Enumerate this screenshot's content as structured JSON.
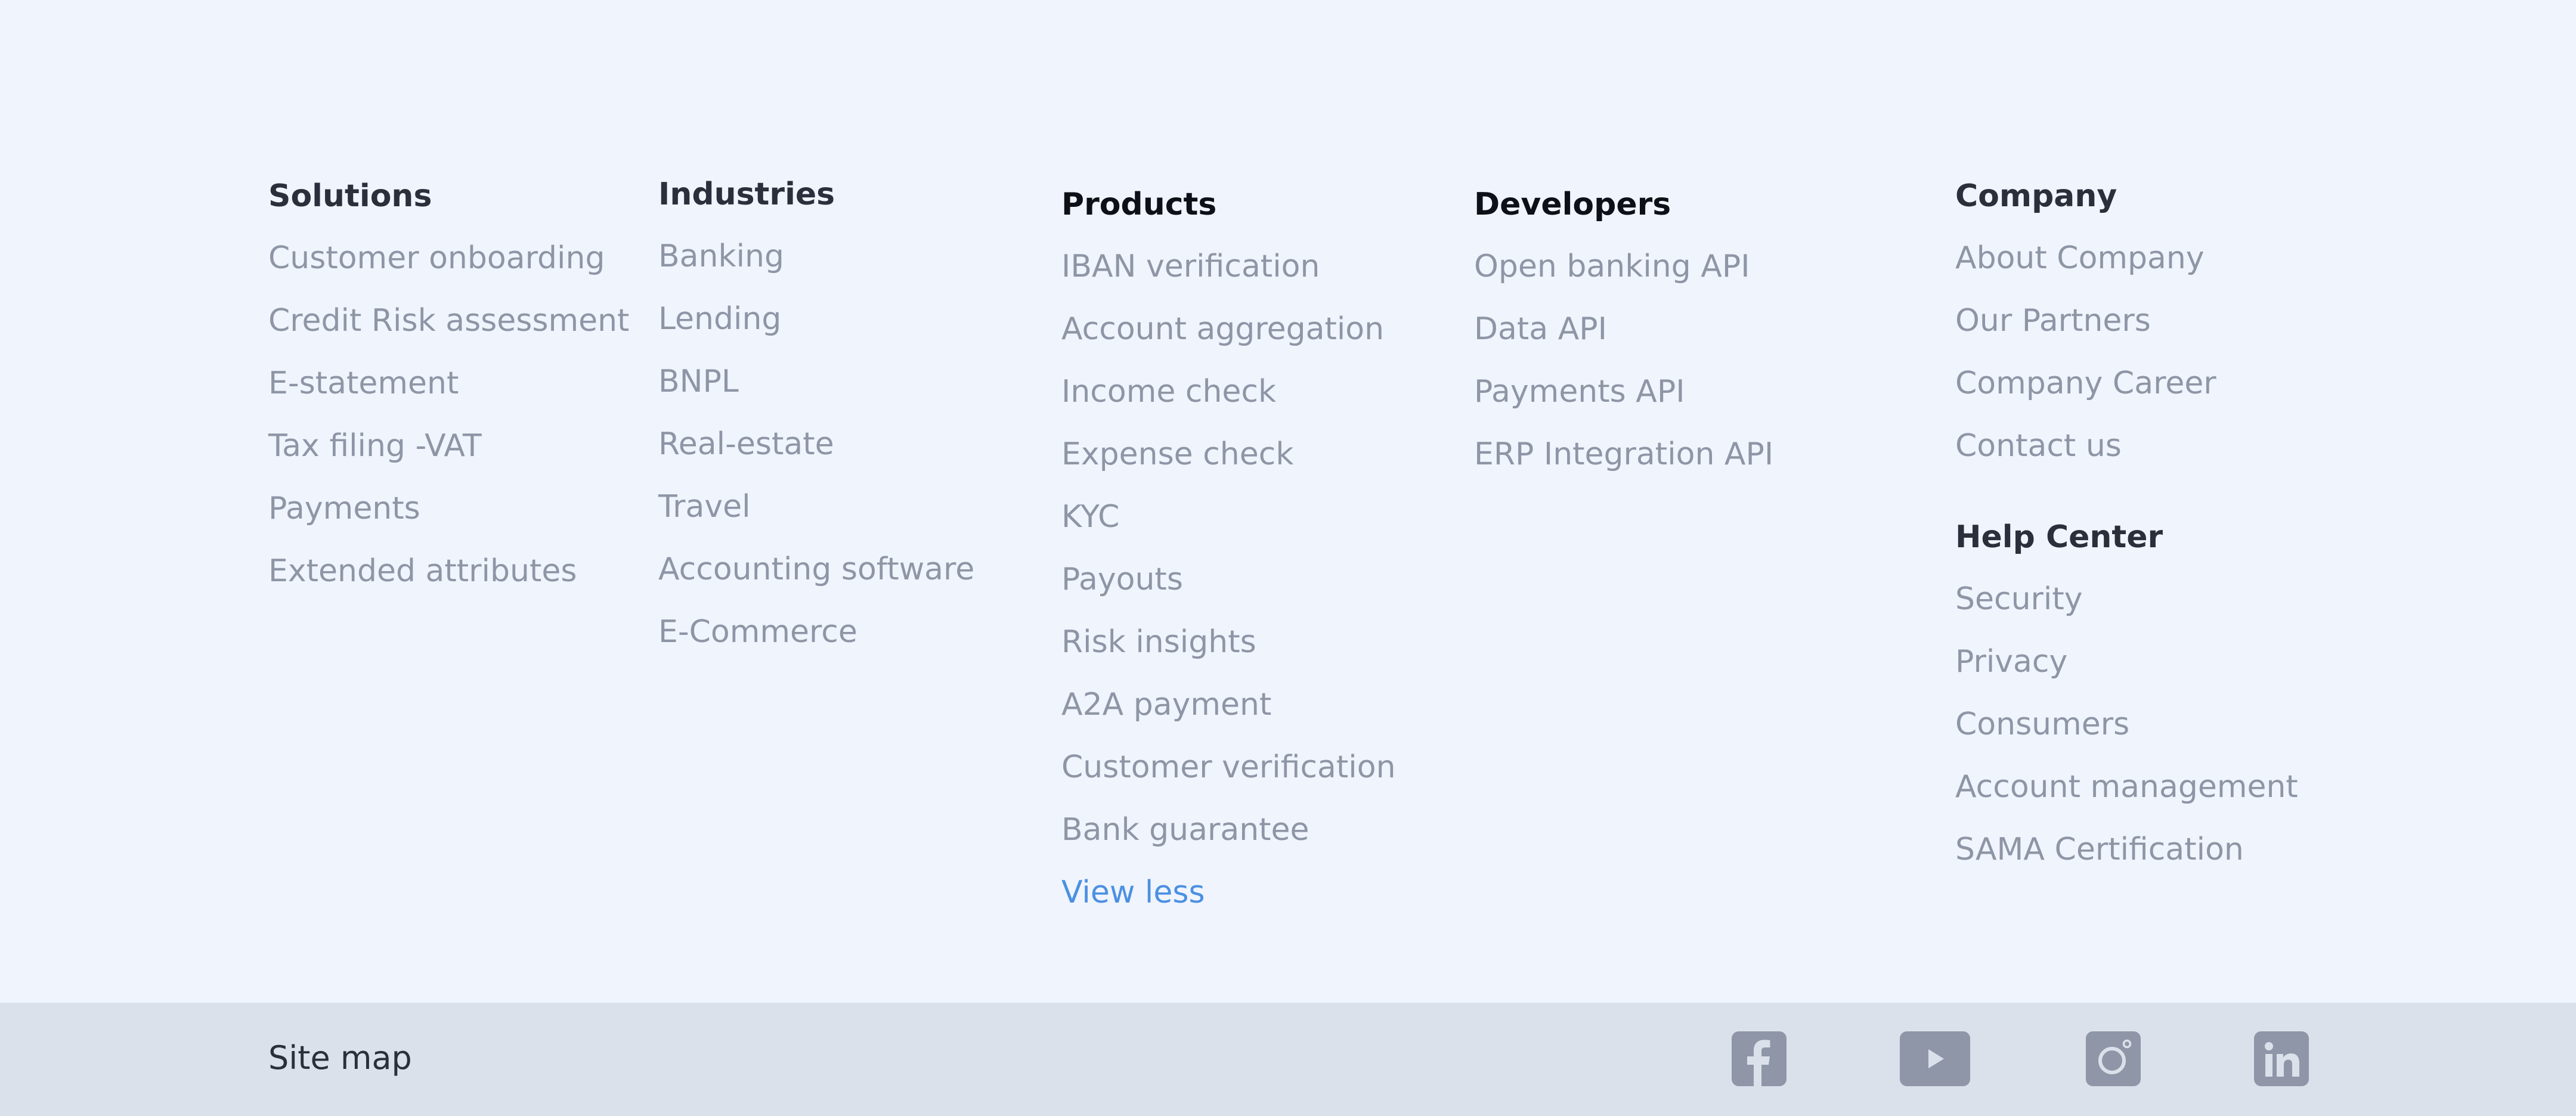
{
  "solutions": {
    "title": "Solutions",
    "items": [
      "Customer onboarding",
      "Credit Risk assessment",
      "E-statement",
      "Tax filing -VAT",
      "Payments",
      "Extended attributes"
    ]
  },
  "industries": {
    "title": "Industries",
    "items": [
      "Banking",
      "Lending",
      "BNPL",
      "Real-estate",
      "Travel",
      "Accounting software",
      "E-Commerce"
    ]
  },
  "products": {
    "title": "Products",
    "items": [
      "IBAN verification",
      "Account aggregation",
      "Income check",
      "Expense check",
      "KYC",
      "Payouts",
      "Risk insights",
      "A2A payment",
      "Customer verification",
      "Bank guarantee"
    ],
    "toggle_label": "View less"
  },
  "developers": {
    "title": "Developers",
    "items": [
      "Open banking API",
      "Data API",
      "Payments API",
      "ERP Integration API"
    ]
  },
  "company": {
    "title": "Company",
    "items": [
      "About Company",
      "Our Partners",
      "Company Career",
      "Contact us"
    ]
  },
  "help_center": {
    "title": "Help Center",
    "items": [
      "Security",
      "Privacy",
      "Consumers",
      "Account management",
      "SAMA Certification"
    ]
  },
  "bottom_bar": {
    "sitemap_label": "Site map",
    "social_icons": [
      "facebook-icon",
      "youtube-icon",
      "instagram-icon",
      "linkedin-icon"
    ]
  },
  "colors": {
    "background": "#f0f4fc",
    "bottom_bar": "#dbe1ea",
    "heading": "#2a2f3b",
    "link": "#8e96a6",
    "accent": "#4b90e2",
    "icon": "#8e96a8"
  }
}
